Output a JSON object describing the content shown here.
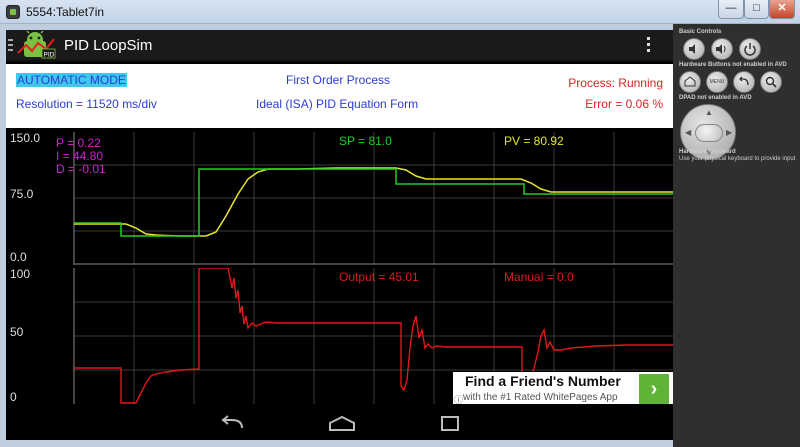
{
  "window": {
    "title": "5554:Tablet7in",
    "minimize": "—",
    "maximize": "□",
    "close": "✕"
  },
  "app": {
    "name": "PID LoopSim",
    "logo_text": "PID",
    "overflow_icon": "overflow-menu-icon"
  },
  "info": {
    "mode": "AUTOMATIC MODE",
    "resolution": "Resolution = 11520 ms/div",
    "process_type": "First Order Process",
    "equation_form": "Ideal (ISA) PID Equation Form",
    "status": "Process: Running",
    "error": "Error = 0.06 %"
  },
  "graph_pv": {
    "y_ticks": [
      "150.0",
      "75.0",
      "0.0"
    ],
    "p": "P = 0.22",
    "i": "I = 44.80",
    "d": "D = -0.01",
    "sp": "SP = 81.0",
    "pv": "PV = 80.92"
  },
  "graph_out": {
    "y_ticks": [
      "100",
      "50",
      "0"
    ],
    "output": "Output = 45.01",
    "manual": "Manual = 0.0"
  },
  "ad": {
    "headline": "Find a Friend's Number",
    "subline": "with the #1 Rated WhitePages App",
    "info_icon": "ⓘ",
    "go_icon": "›"
  },
  "navbar": {
    "back": "⟲",
    "home": "⌂",
    "recent": "▭"
  },
  "emulator_controls": {
    "basic_label": "Basic Controls",
    "hw_buttons_label": "Hardware Buttons not enabled in AVD",
    "menu_label": "MENU",
    "dpad_label": "DPAD not enabled in AVD",
    "keyboard_label": "Hardware Keyboard",
    "keyboard_hint": "Use your physical keyboard to provide input"
  },
  "colors": {
    "setpoint": "#22cc22",
    "process_value": "#e6e62e",
    "output": "#e01818",
    "pid_params": "#d020d0",
    "grid": "#3a3a3a"
  }
}
